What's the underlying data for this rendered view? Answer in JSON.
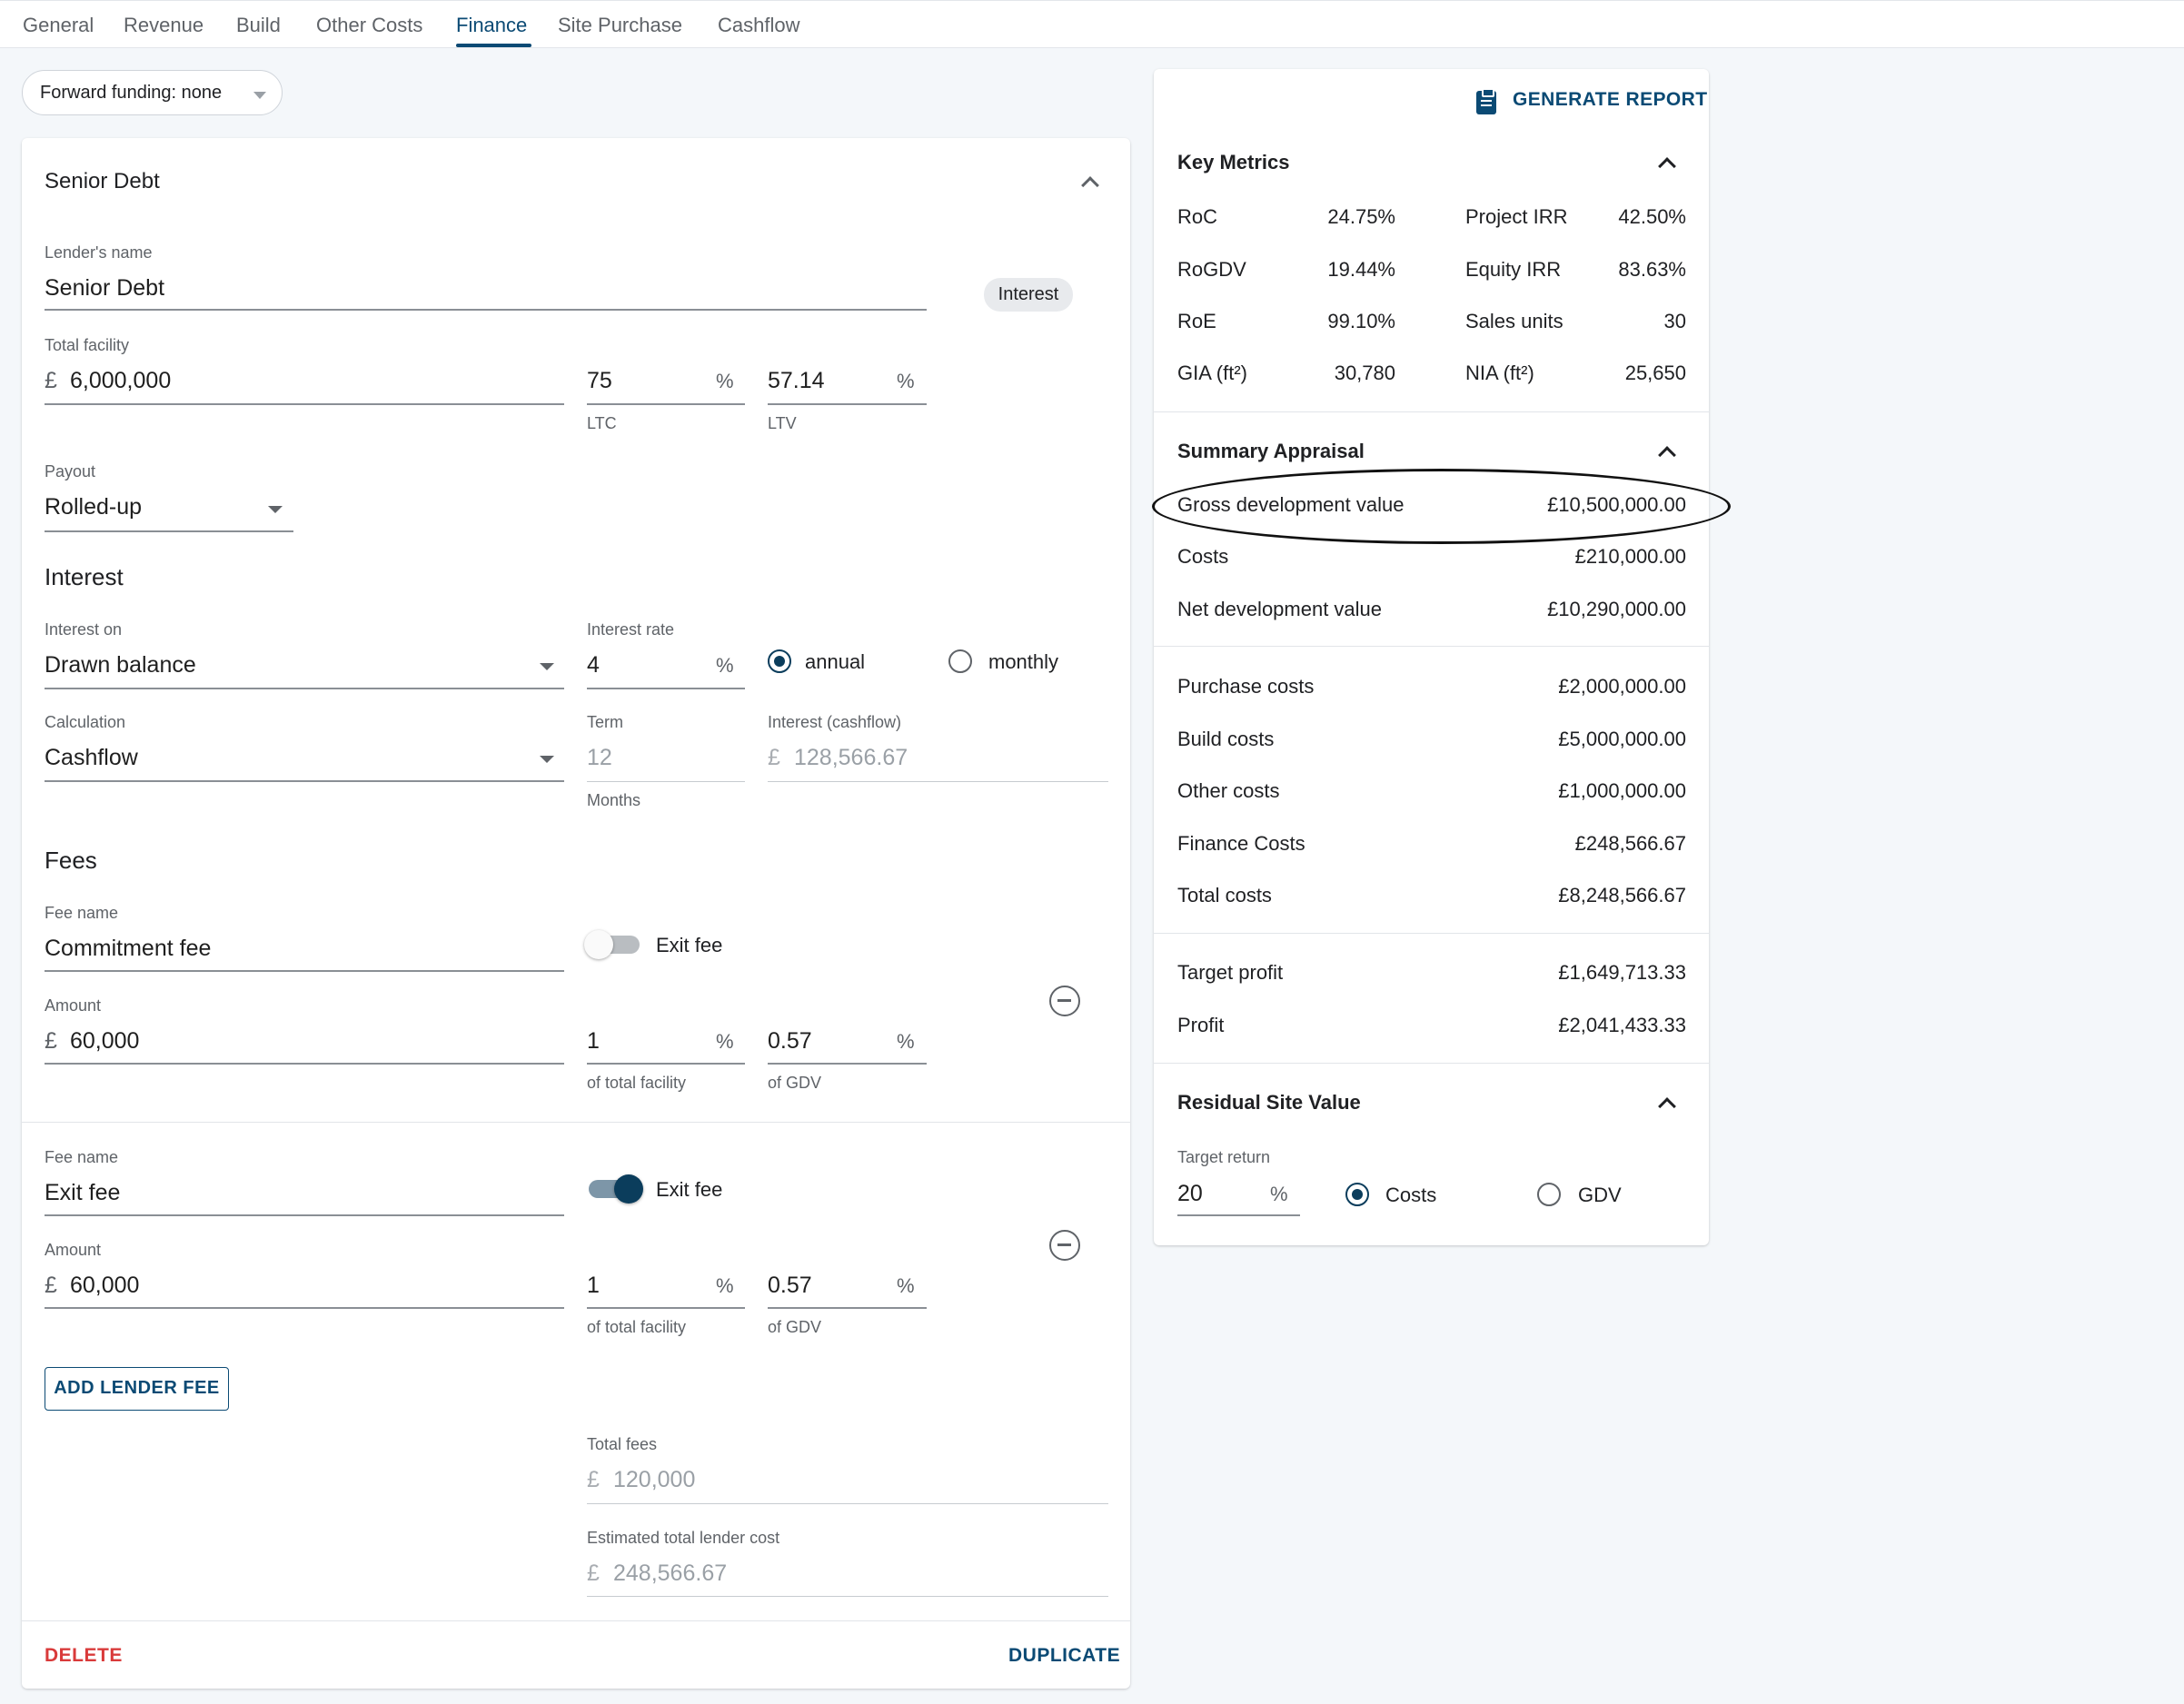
{
  "tabs": [
    "General",
    "Revenue",
    "Build",
    "Other Costs",
    "Finance",
    "Site Purchase",
    "Cashflow"
  ],
  "active_tab": "Finance",
  "forward_funding": "Forward funding: none",
  "senior_debt": {
    "title": "Senior Debt",
    "lender_name_label": "Lender's name",
    "lender_name": "Senior Debt",
    "badge": "Interest",
    "total_facility_label": "Total facility",
    "currency": "£",
    "total_facility": "6,000,000",
    "ltc": "75",
    "ltc_label": "LTC",
    "ltv": "57.14",
    "ltv_label": "LTV",
    "percent": "%",
    "payout_label": "Payout",
    "payout": "Rolled-up"
  },
  "interest": {
    "title": "Interest",
    "interest_on_label": "Interest on",
    "interest_on": "Drawn balance",
    "rate_label": "Interest rate",
    "rate": "4",
    "annual": "annual",
    "monthly": "monthly",
    "selected_period": "annual",
    "calculation_label": "Calculation",
    "calculation": "Cashflow",
    "term_label": "Term",
    "term": "12",
    "term_unit": "Months",
    "interest_cashflow_label": "Interest (cashflow)",
    "interest_cashflow": "128,566.67"
  },
  "fees": {
    "title": "Fees",
    "items": [
      {
        "fee_name_label": "Fee name",
        "fee_name": "Commitment fee",
        "exit_fee_label": "Exit fee",
        "exit_fee": false,
        "amount_label": "Amount",
        "amount": "60,000",
        "pct_facility": "1",
        "pct_facility_label": "of total facility",
        "pct_gdv": "0.57",
        "pct_gdv_label": "of GDV"
      },
      {
        "fee_name_label": "Fee name",
        "fee_name": "Exit fee",
        "exit_fee_label": "Exit fee",
        "exit_fee": true,
        "amount_label": "Amount",
        "amount": "60,000",
        "pct_facility": "1",
        "pct_facility_label": "of total facility",
        "pct_gdv": "0.57",
        "pct_gdv_label": "of GDV"
      }
    ],
    "add_button": "ADD LENDER FEE",
    "total_fees_label": "Total fees",
    "total_fees": "120,000",
    "est_total_label": "Estimated total lender cost",
    "est_total": "248,566.67"
  },
  "footer": {
    "delete": "DELETE",
    "duplicate": "DUPLICATE"
  },
  "panel": {
    "generate_report": "GENERATE REPORT",
    "key_metrics": {
      "title": "Key Metrics",
      "rows": [
        [
          "RoC",
          "24.75%",
          "Project IRR",
          "42.50%"
        ],
        [
          "RoGDV",
          "19.44%",
          "Equity IRR",
          "83.63%"
        ],
        [
          "RoE",
          "99.10%",
          "Sales units",
          "30"
        ],
        [
          "GIA (ft²)",
          "30,780",
          "NIA (ft²)",
          "25,650"
        ]
      ]
    },
    "summary": {
      "title": "Summary Appraisal",
      "group1": [
        [
          "Gross development value",
          "£10,500,000.00"
        ],
        [
          "Costs",
          "£210,000.00"
        ],
        [
          "Net development value",
          "£10,290,000.00"
        ]
      ],
      "group2": [
        [
          "Purchase costs",
          "£2,000,000.00"
        ],
        [
          "Build costs",
          "£5,000,000.00"
        ],
        [
          "Other costs",
          "£1,000,000.00"
        ],
        [
          "Finance Costs",
          "£248,566.67"
        ],
        [
          "Total costs",
          "£8,248,566.67"
        ]
      ],
      "group3": [
        [
          "Target profit",
          "£1,649,713.33"
        ],
        [
          "Profit",
          "£2,041,433.33"
        ]
      ]
    },
    "residual": {
      "title": "Residual Site Value",
      "target_return_label": "Target return",
      "target_return": "20",
      "costs": "Costs",
      "gdv": "GDV",
      "selected": "Costs"
    }
  },
  "colors": {
    "accent": "#0b4a74",
    "danger": "#d93a3a",
    "radio_fill": "#0b3d5c",
    "switch_on": "#0b3d5c"
  }
}
